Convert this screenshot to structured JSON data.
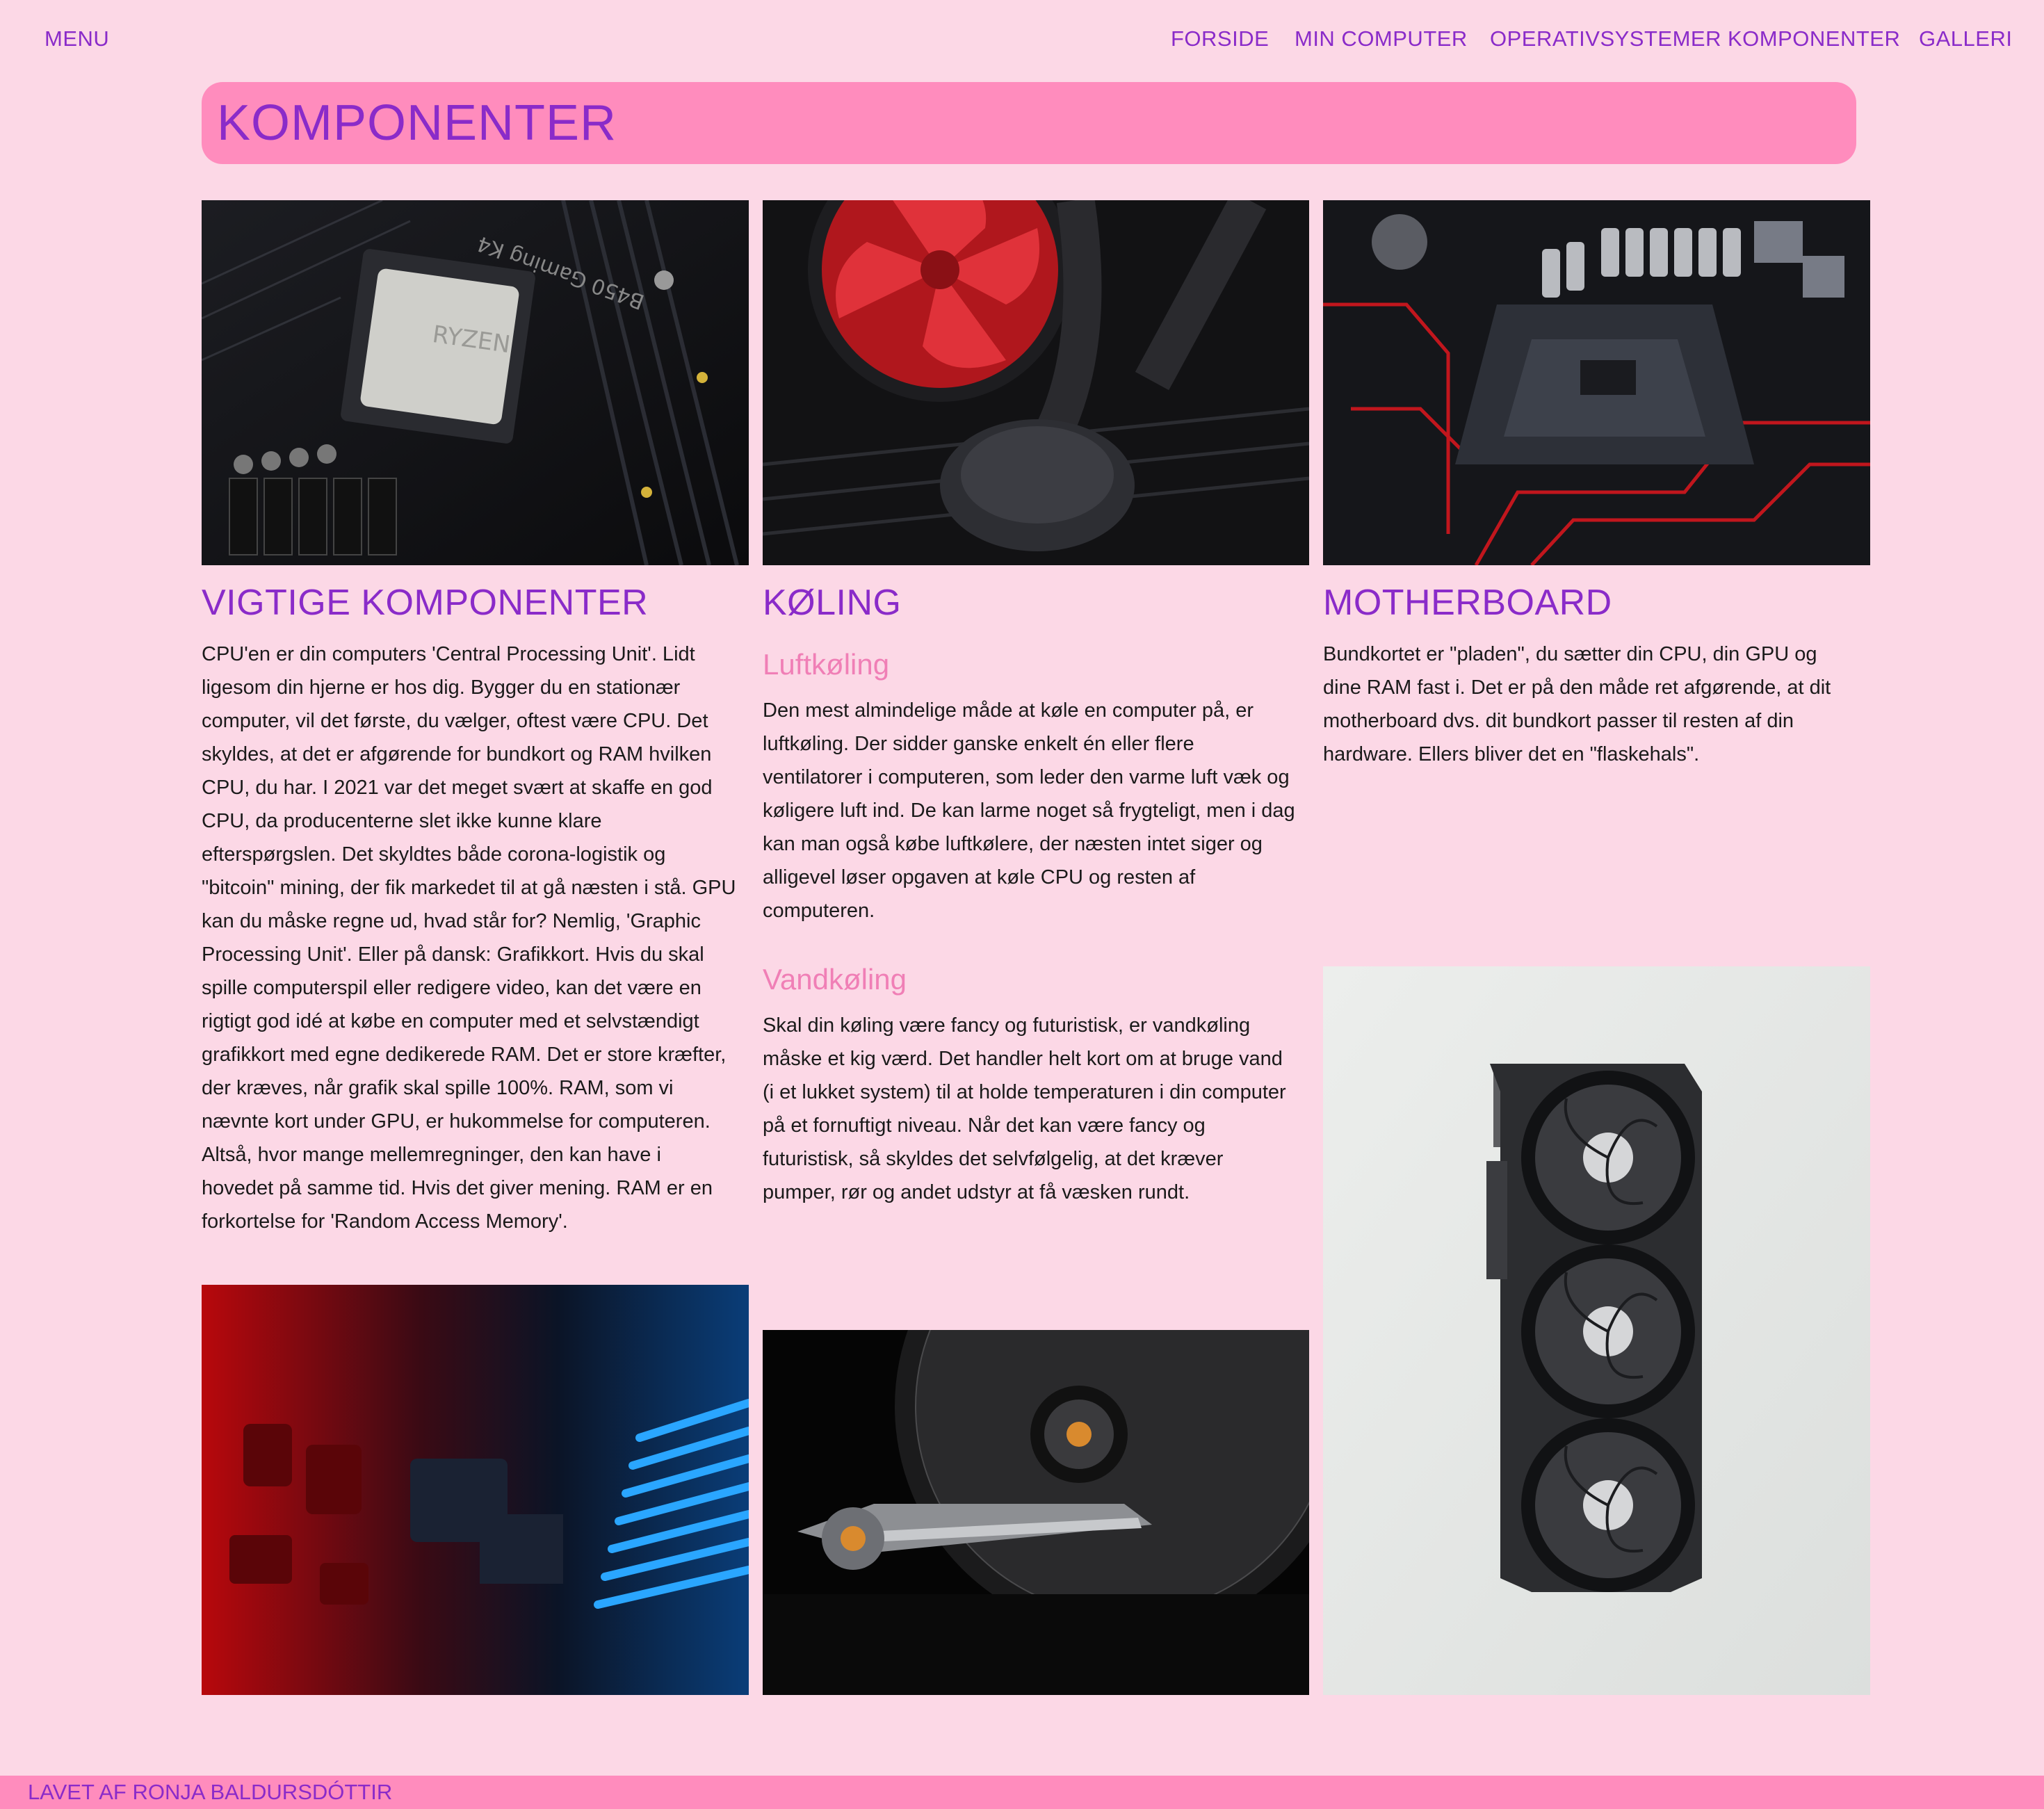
{
  "nav": {
    "menu": "MENU",
    "items": [
      "FORSIDE",
      "MIN COMPUTER",
      "OPERATIVSYSTEMER",
      "KOMPONENTER",
      "GALLERI"
    ]
  },
  "page_title": "KOMPONENTER",
  "col1": {
    "heading": "VIGTIGE KOMPONENTER",
    "text": "CPU'en er din computers 'Central Processing Unit'. Lidt ligesom din hjerne er hos dig. Bygger du en stationær computer, vil det første, du vælger, oftest være CPU. Det skyldes, at det er afgørende for bundkort og RAM hvilken CPU, du har. I 2021 var det meget svært at skaffe en god CPU, da producenterne slet ikke kunne klare efterspørgslen. Det skyldtes både corona-logistik og \"bitcoin\" mining, der fik markedet til at gå næsten i stå. GPU kan du måske regne ud, hvad står for? Nemlig, 'Graphic Processing Unit'. Eller på dansk: Grafikkort. Hvis du skal spille computerspil eller redigere video, kan det være en rigtigt god idé at købe en computer med et selvstændigt grafikkort med egne dedikerede RAM. Det er store kræfter, der kræves, når grafik skal spille 100%. RAM, som vi nævnte kort under GPU, er hukommelse for computeren. Altså, hvor mange mellemregninger, den kan have i hovedet på samme tid. Hvis det giver mening. RAM er en forkortelse for 'Random Access Memory'."
  },
  "col2": {
    "heading": "KØLING",
    "sub1": "Luftkøling",
    "text1": "Den mest almindelige måde at køle en computer på, er luftkøling. Der sidder ganske enkelt én eller flere ventilatorer i computeren, som leder den varme luft væk og køligere luft ind. De kan larme noget så frygteligt, men i dag kan man også købe luftkølere, der næsten intet siger og alligevel løser opgaven at køle CPU og resten af computeren.",
    "sub2": "Vandkøling",
    "text2": "Skal din køling være fancy og futuristisk, er vandkøling måske et kig værd. Det handler helt kort om at bruge vand (i et lukket system) til at holde temperaturen i din computer på et fornuftigt niveau. Når det kan være fancy og futuristisk, så skyldes det selvfølgelig, at det kræver pumper, rør og andet udstyr at få væsken rundt."
  },
  "col3": {
    "heading": "MOTHERBOARD",
    "text": "Bundkortet er \"pladen\", du sætter din CPU, din GPU og dine RAM fast i. Det er på den måde ret afgørende, at dit motherboard dvs. dit bundkort passer til resten af din hardware. Ellers bliver det en \"flaskehals\"."
  },
  "images": {
    "cpu_photo": "ryzen-cpu-photo",
    "fan_photo": "cpu-cooler-photo",
    "socket_photo": "motherboard-socket-photo",
    "circuit_photo": "circuit-board-photo",
    "hdd_photo": "hard-drive-photo",
    "gpu_photo": "graphics-card-photo",
    "cpu_label": "RYZEN",
    "board_label": "B450 Gaming K4"
  },
  "footer": "LAVET AF RONJA BALDURSDÓTTIR",
  "colors": {
    "background": "#fcd8e6",
    "accent_pink": "#ff8cbd",
    "heading_purple": "#8a2bc9",
    "subheading_pink": "#f07fb6"
  }
}
